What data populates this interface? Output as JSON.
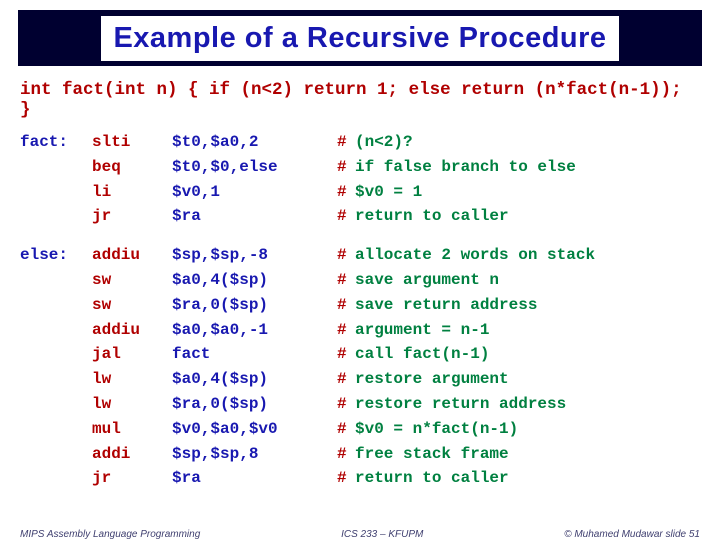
{
  "title": "Example of a Recursive Procedure",
  "code_c": "int fact(int n) { if (n<2) return 1; else return (n*fact(n-1)); }",
  "blocks": [
    {
      "label": "fact:",
      "rows": [
        {
          "instr": "slti",
          "ops": "$t0,$a0,2",
          "comment": "(n<2)?"
        },
        {
          "instr": "beq",
          "ops": "$t0,$0,else",
          "comment": "if false branch to else"
        },
        {
          "instr": "li",
          "ops": "$v0,1",
          "comment": "$v0 = 1"
        },
        {
          "instr": "jr",
          "ops": "$ra",
          "comment": "return to caller"
        }
      ]
    },
    {
      "label": "else:",
      "rows": [
        {
          "instr": "addiu",
          "ops": "$sp,$sp,-8",
          "comment": "allocate 2 words on stack"
        },
        {
          "instr": "sw",
          "ops": "$a0,4($sp)",
          "comment": "save argument n"
        },
        {
          "instr": "sw",
          "ops": "$ra,0($sp)",
          "comment": "save return address"
        },
        {
          "instr": "addiu",
          "ops": "$a0,$a0,-1",
          "comment": "argument = n-1"
        },
        {
          "instr": "jal",
          "ops": "fact",
          "comment": "call fact(n-1)"
        },
        {
          "instr": "lw",
          "ops": "$a0,4($sp)",
          "comment": "restore argument"
        },
        {
          "instr": "lw",
          "ops": "$ra,0($sp)",
          "comment": "restore return address"
        },
        {
          "instr": "mul",
          "ops": "$v0,$a0,$v0",
          "comment": "$v0 = n*fact(n-1)"
        },
        {
          "instr": "addi",
          "ops": "$sp,$sp,8",
          "comment": "free stack frame"
        },
        {
          "instr": "jr",
          "ops": "$ra",
          "comment": "return to caller"
        }
      ]
    }
  ],
  "footer": {
    "left": "MIPS Assembly Language Programming",
    "center": "ICS 233 – KFUPM",
    "right": "© Muhamed Mudawar   slide 51"
  }
}
